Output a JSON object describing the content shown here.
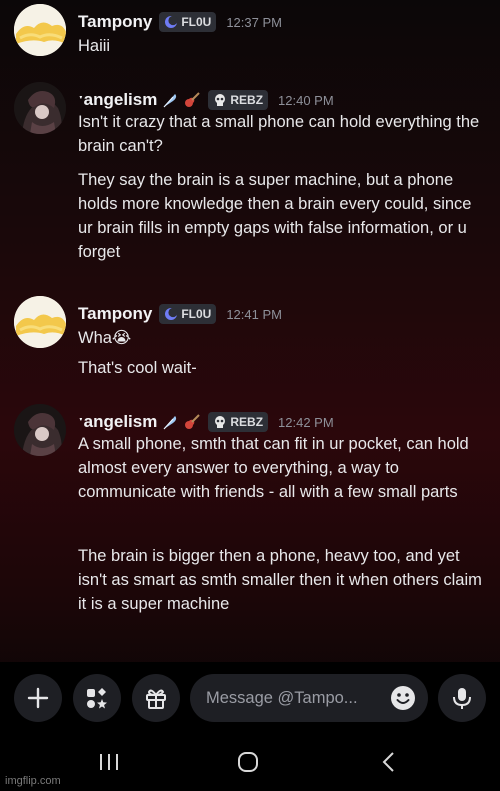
{
  "messages": [
    {
      "username": "Tampony",
      "tag": "FL0U",
      "time": "12:37 PM",
      "lines": [
        "Haiii"
      ]
    },
    {
      "username": "ˑangelism",
      "tag": "REBZ",
      "time": "12:40 PM",
      "lines": [
        "Isn't it crazy that a small phone can hold everything the brain can't?",
        "They say the brain is a super machine, but a phone holds more knowledge then a brain every could, since ur brain fills in empty gaps with false information, or u forget"
      ]
    },
    {
      "username": "Tampony",
      "tag": "FL0U",
      "time": "12:41 PM",
      "lines": [
        "Wha😭",
        "That's cool wait-"
      ]
    },
    {
      "username": "ˑangelism",
      "tag": "REBZ",
      "time": "12:42 PM",
      "lines": [
        "A small phone, smth that can fit in ur pocket, can hold almost every answer to everything, a way to communicate with friends - all with a few small parts",
        "The brain is bigger then a phone, heavy too, and yet isn't as smart as smth smaller then it when others claim it is a super machine"
      ]
    }
  ],
  "composer": {
    "placeholder": "Message @Tampo..."
  },
  "icons": {
    "add": "plus-icon",
    "apps": "apps-icon",
    "gift": "gift-icon",
    "emoji": "emoji-icon",
    "mic": "microphone-icon",
    "nav_recents": "recents-icon",
    "nav_home": "home-icon",
    "nav_back": "back-icon"
  },
  "colors": {
    "tag_bg": "#2d2f36",
    "composer_bg": "#1e1f24"
  },
  "watermark": "imgflip.com"
}
